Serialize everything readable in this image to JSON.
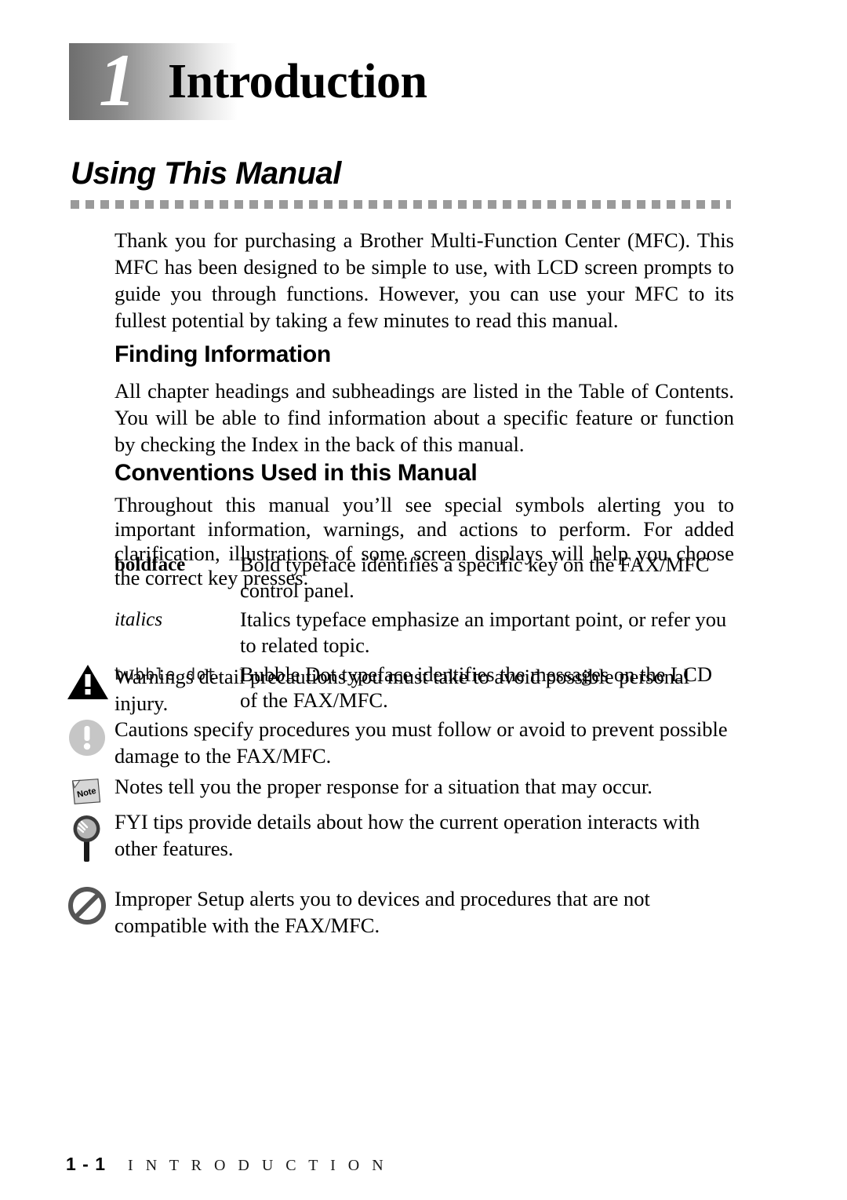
{
  "chapter": {
    "number": "1",
    "title": "Introduction"
  },
  "section": {
    "title": "Using This Manual",
    "intro_paragraph": "Thank you for purchasing a Brother Multi-Function Center (MFC). This MFC has been designed to be simple to use, with LCD screen prompts to guide you through functions. However, you can use your MFC to its fullest potential by taking a few minutes to read this manual."
  },
  "finding_information": {
    "heading": "Finding Information",
    "paragraph": "All chapter headings and subheadings are listed in the Table of Contents. You will be able to find information about a specific feature or function by checking the Index in the back of this manual."
  },
  "conventions": {
    "heading": "Conventions Used in this Manual",
    "paragraph": "Throughout this manual you’ll see special symbols alerting you to important information, warnings, and actions to perform. For added clarification, illustrations of some screen displays will help you choose the correct key presses.",
    "rows": [
      {
        "term": "boldface",
        "style": "bold",
        "description": "Bold typeface identifies a specific key on the FAX/MFC control panel."
      },
      {
        "term": "italics",
        "style": "italic",
        "description": "Italics typeface emphasize an important point, or refer you to related topic."
      },
      {
        "term": "bubble dot",
        "style": "mono",
        "description": "Bubble Dot typeface identifies the messages on the LCD of the FAX/MFC."
      }
    ]
  },
  "symbol_notes": [
    {
      "icon": "warning-triangle-icon",
      "text": "Warnings detail precautions you must take to avoid possible personal injury."
    },
    {
      "icon": "caution-exclamation-icon",
      "text": "Cautions specify procedures you must follow or avoid to prevent possible damage to the FAX/MFC."
    },
    {
      "icon": "note-sticky-icon",
      "label": "Note",
      "text": "Notes tell you the proper response for a situation that may occur."
    },
    {
      "icon": "magnifier-fyi-icon",
      "text": "FYI tips provide details about how the current operation interacts with other features."
    },
    {
      "icon": "prohibited-icon",
      "text": "Improper Setup alerts you to devices and procedures that are not compatible with the FAX/MFC."
    }
  ],
  "footer": {
    "page_number": "1 - 1",
    "chapter_label": "I N T R O D U C T I O N"
  },
  "colors": {
    "rule_gray": "#9a9a9a",
    "icon_gray": "#c6c6c6",
    "text_black": "#000000"
  }
}
